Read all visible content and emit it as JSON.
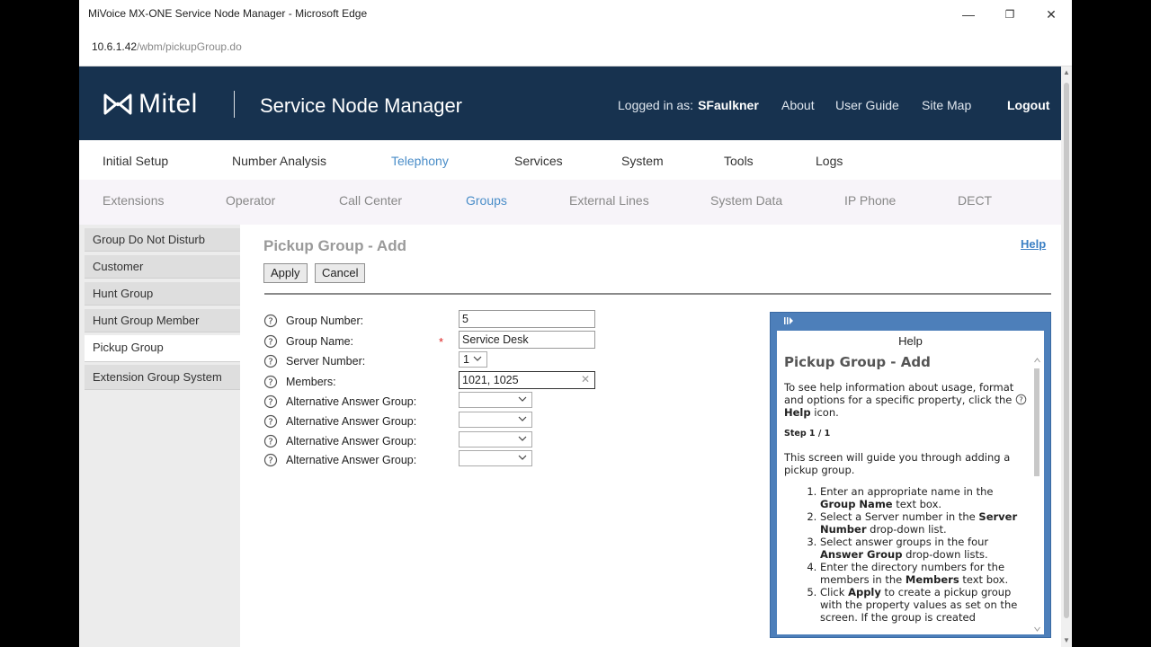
{
  "browser": {
    "window_title": "MiVoice MX-ONE Service Node Manager - Microsoft Edge",
    "url_host": "10.6.1.42",
    "url_path": "/wbm/pickupGroup.do",
    "controls": {
      "minimize": "—",
      "restore": "❐",
      "close": "✕"
    }
  },
  "header": {
    "brand": "Mitel",
    "product": "Service Node Manager",
    "logged_in_label": "Logged in as:",
    "username": "SFaulkner",
    "links": [
      "About",
      "User Guide",
      "Site Map"
    ],
    "logout": "Logout",
    "bg_color": "#17324f"
  },
  "menu_primary": {
    "items": [
      "Initial Setup",
      "Number Analysis",
      "Telephony",
      "Services",
      "System",
      "Tools",
      "Logs"
    ],
    "active": "Telephony"
  },
  "menu_secondary": {
    "items": [
      "Extensions",
      "Operator",
      "Call Center",
      "Groups",
      "External Lines",
      "System Data",
      "IP Phone",
      "DECT"
    ],
    "active": "Groups"
  },
  "sidebar": {
    "items": [
      "Group Do Not Disturb",
      "Customer",
      "Hunt Group",
      "Hunt Group Member",
      "Pickup Group",
      "Extension Group System"
    ],
    "active": "Pickup Group"
  },
  "page": {
    "title": "Pickup Group - Add",
    "help_link": "Help",
    "apply": "Apply",
    "cancel": "Cancel"
  },
  "form": {
    "group_number": {
      "label": "Group Number:",
      "value": "5"
    },
    "group_name": {
      "label": "Group Name:",
      "value": "Service Desk",
      "required": "*"
    },
    "server_number": {
      "label": "Server Number:",
      "value": "1"
    },
    "members": {
      "label": "Members:",
      "value": "1021, 1025"
    },
    "alt_answer": [
      {
        "label": "Alternative Answer Group:",
        "value": ""
      },
      {
        "label": "Alternative Answer Group:",
        "value": ""
      },
      {
        "label": "Alternative Answer Group:",
        "value": ""
      },
      {
        "label": "Alternative Answer Group:",
        "value": ""
      }
    ]
  },
  "help_panel": {
    "header": "Help",
    "title": "Pickup Group - Add",
    "intro_1": "To see help information about usage, format and options for a specific property, click the",
    "intro_icon_label": "Help",
    "intro_2": "icon.",
    "step": "Step 1 / 1",
    "guide": "This screen will guide you through adding a pickup group.",
    "steps": [
      {
        "a": "Enter an appropriate name in the ",
        "b": "Group Name",
        "c": " text box."
      },
      {
        "a": "Select a Server number in the ",
        "b": "Server Number",
        "c": " drop-down list."
      },
      {
        "a": "Select answer groups in the four ",
        "b": "Answer Group",
        "c": " drop-down lists."
      },
      {
        "a": "Enter the directory numbers for the members in the ",
        "b": "Members",
        "c": " text box."
      },
      {
        "a": "Click ",
        "b": "Apply",
        "c": " to create a pickup group with the property values as set on the screen. If the group is created"
      }
    ]
  }
}
